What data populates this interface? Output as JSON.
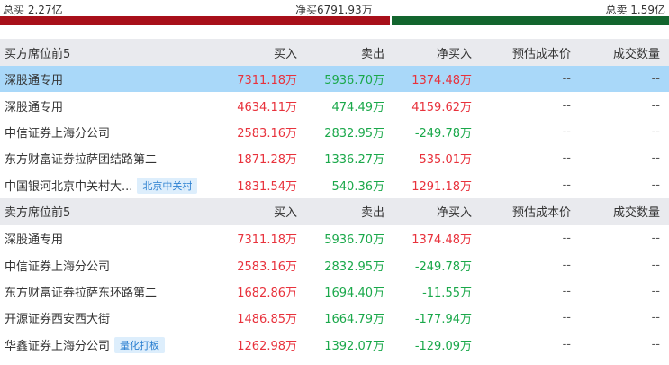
{
  "summary": {
    "total_buy": "总买 2.27亿",
    "net_buy": "净买6791.93万",
    "total_sell": "总卖 1.59亿"
  },
  "columns": [
    "买入",
    "卖出",
    "净买入",
    "预估成本价",
    "成交数量"
  ],
  "buy_section": {
    "title": "买方席位前5",
    "rows": [
      {
        "name": "深股通专用",
        "tag": "",
        "buy": "7311.18万",
        "sell": "5936.70万",
        "net": "1374.48万",
        "net_sign": "pos",
        "cost": "--",
        "qty": "--",
        "selected": true
      },
      {
        "name": "深股通专用",
        "tag": "",
        "buy": "4634.11万",
        "sell": "474.49万",
        "net": "4159.62万",
        "net_sign": "pos",
        "cost": "--",
        "qty": "--"
      },
      {
        "name": "中信证券上海分公司",
        "tag": "",
        "buy": "2583.16万",
        "sell": "2832.95万",
        "net": "-249.78万",
        "net_sign": "neg",
        "cost": "--",
        "qty": "--"
      },
      {
        "name": "东方财富证券拉萨团结路第二",
        "tag": "",
        "buy": "1871.28万",
        "sell": "1336.27万",
        "net": "535.01万",
        "net_sign": "pos",
        "cost": "--",
        "qty": "--"
      },
      {
        "name": "中国银河北京中关村大...",
        "tag": "北京中关村",
        "buy": "1831.54万",
        "sell": "540.36万",
        "net": "1291.18万",
        "net_sign": "pos",
        "cost": "--",
        "qty": "--"
      }
    ]
  },
  "sell_section": {
    "title": "卖方席位前5",
    "rows": [
      {
        "name": "深股通专用",
        "tag": "",
        "buy": "7311.18万",
        "sell": "5936.70万",
        "net": "1374.48万",
        "net_sign": "pos",
        "cost": "--",
        "qty": "--"
      },
      {
        "name": "中信证券上海分公司",
        "tag": "",
        "buy": "2583.16万",
        "sell": "2832.95万",
        "net": "-249.78万",
        "net_sign": "neg",
        "cost": "--",
        "qty": "--"
      },
      {
        "name": "东方财富证券拉萨东环路第二",
        "tag": "",
        "buy": "1682.86万",
        "sell": "1694.40万",
        "net": "-11.55万",
        "net_sign": "neg",
        "cost": "--",
        "qty": "--"
      },
      {
        "name": "开源证券西安西大街",
        "tag": "",
        "buy": "1486.85万",
        "sell": "1664.79万",
        "net": "-177.94万",
        "net_sign": "neg",
        "cost": "--",
        "qty": "--"
      },
      {
        "name": "华鑫证券上海分公司",
        "tag": "量化打板",
        "buy": "1262.98万",
        "sell": "1392.07万",
        "net": "-129.09万",
        "net_sign": "neg",
        "cost": "--",
        "qty": "--"
      }
    ]
  },
  "colors": {
    "bar_buy": "#a8101a",
    "bar_sell": "#13652e",
    "red": "#e8323c",
    "green": "#1aa84a",
    "header_bg": "#e9eaee",
    "selected_bg": "#a9d8f9",
    "tag_text": "#2a7fd0",
    "tag_bg": "#ddeefc"
  }
}
